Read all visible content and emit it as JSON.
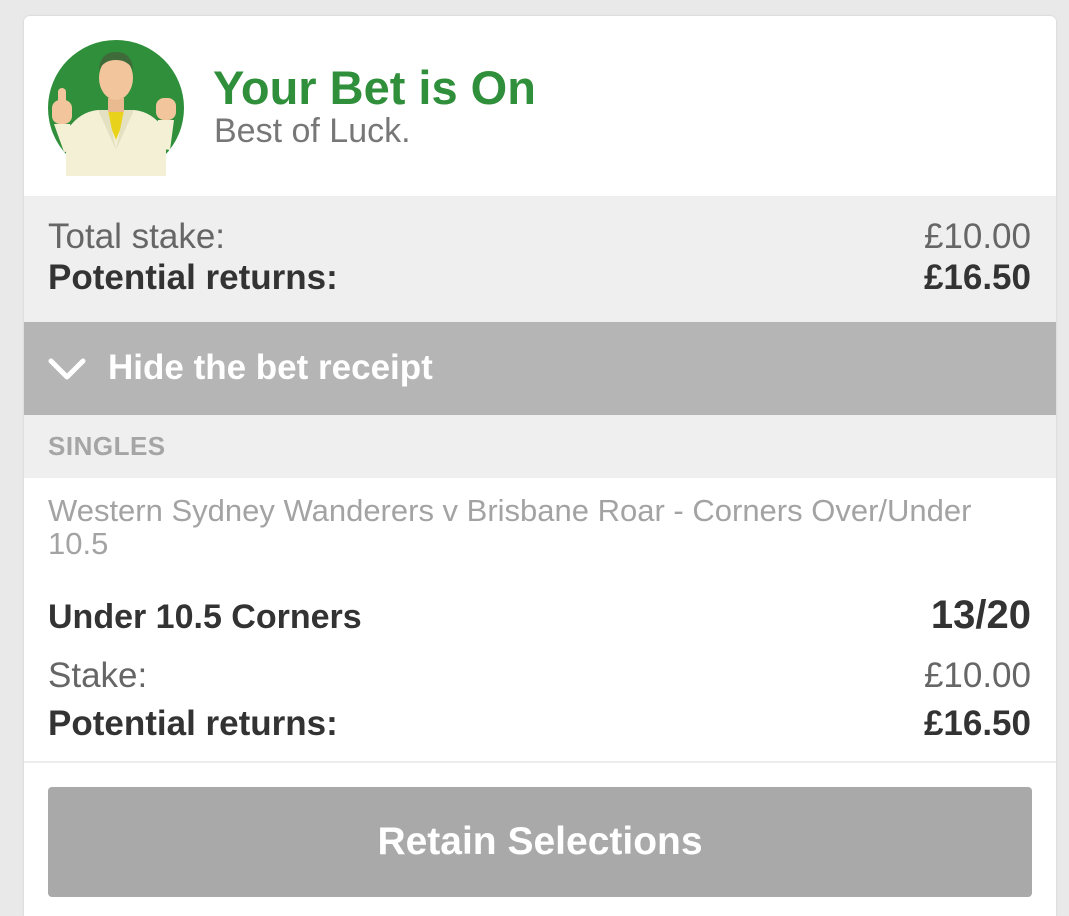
{
  "header": {
    "title": "Your Bet is On",
    "subtitle": "Best of Luck.",
    "avatar_icon": "happy-man-avatar-icon"
  },
  "totals": {
    "stake_label": "Total stake:",
    "stake_value": "£10.00",
    "returns_label": "Potential returns:",
    "returns_value": "£16.50"
  },
  "receipt_toggle": {
    "icon": "chevron-down-icon",
    "label": "Hide the bet receipt"
  },
  "singles": {
    "section_label": "SINGLES",
    "bets": [
      {
        "event": "Western Sydney Wanderers v Brisbane Roar - Corners Over/Under 10.5",
        "selection": "Under 10.5 Corners",
        "odds": "13/20",
        "stake_label": "Stake:",
        "stake_value": "£10.00",
        "returns_label": "Potential returns:",
        "returns_value": "£16.50"
      }
    ]
  },
  "actions": {
    "retain_label": "Retain Selections"
  },
  "colors": {
    "brand_green": "#2f8f3a",
    "toggle_bar": "#b5b5b5",
    "button_gray": "#a9a9a9"
  }
}
